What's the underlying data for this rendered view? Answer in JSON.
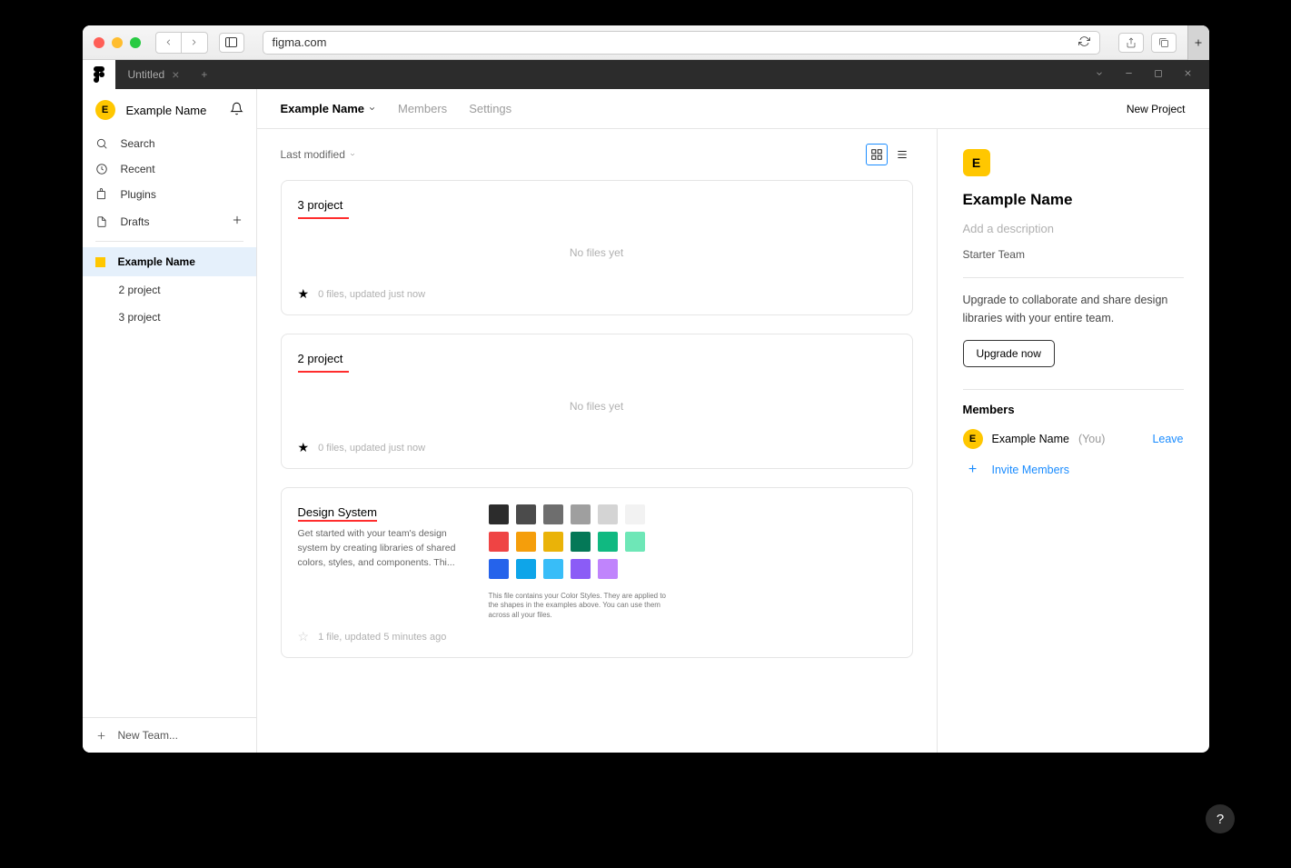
{
  "browser": {
    "url": "figma.com"
  },
  "app_tabs": {
    "untitled": "Untitled"
  },
  "sidebar": {
    "user_initial": "E",
    "user_name": "Example Name",
    "search": "Search",
    "recent": "Recent",
    "plugins": "Plugins",
    "drafts": "Drafts",
    "team_name": "Example Name",
    "projects": [
      "2 project",
      "3 project"
    ],
    "new_team": "New Team..."
  },
  "header": {
    "team_name": "Example Name",
    "members": "Members",
    "settings": "Settings",
    "new_project": "New Project"
  },
  "sort": {
    "label": "Last modified"
  },
  "projects": [
    {
      "title": "3 project",
      "no_files": "No files yet",
      "status": "0 files, updated just now",
      "starred": true
    },
    {
      "title": "2 project",
      "no_files": "No files yet",
      "status": "0 files, updated just now",
      "starred": true
    }
  ],
  "design_system": {
    "title": "Design System",
    "desc": "Get started with your team's design system by creating libraries of shared colors, styles, and components. Thi...",
    "status": "1 file, updated 5 minutes ago",
    "caption": "This file contains your Color Styles. They are applied to the shapes in the examples above. You can use them across all your files.",
    "colors_row1": [
      "#2c2c2c",
      "#4b4b4b",
      "#6e6e6e",
      "#9f9f9f",
      "#d4d4d4",
      "#f2f2f2"
    ],
    "colors_row2": [
      "#ef4444",
      "#f59e0b",
      "#eab308",
      "#047857",
      "#10b981",
      "#6ee7b7"
    ],
    "colors_row3": [
      "#2563eb",
      "#0ea5e9",
      "#38bdf8",
      "#8b5cf6",
      "#c084fc"
    ]
  },
  "right_panel": {
    "initial": "E",
    "name": "Example Name",
    "add_desc": "Add a description",
    "tier": "Starter Team",
    "upgrade_text": "Upgrade to collaborate and share design libraries with your entire team.",
    "upgrade_btn": "Upgrade now",
    "members_title": "Members",
    "member_initial": "E",
    "member_name": "Example Name",
    "member_you": "(You)",
    "leave": "Leave",
    "invite": "Invite Members"
  }
}
